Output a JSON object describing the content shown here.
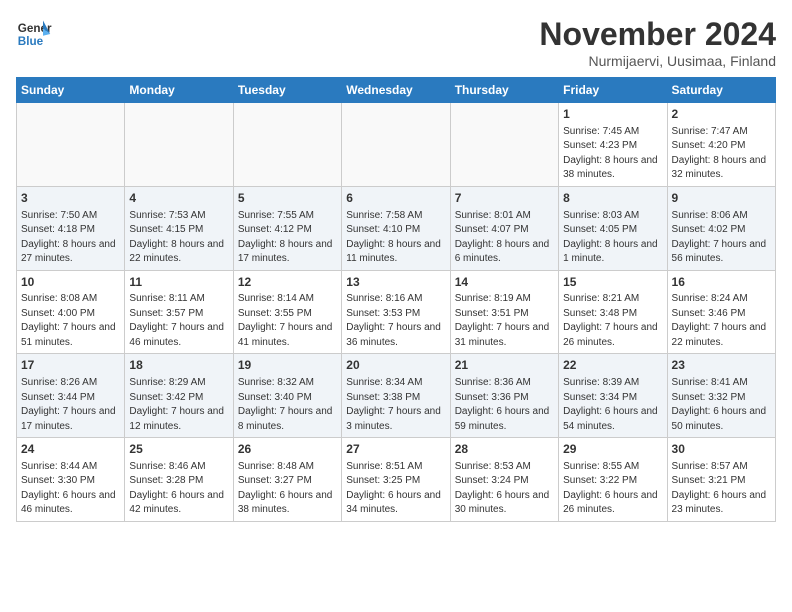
{
  "logo": {
    "line1": "General",
    "line2": "Blue"
  },
  "title": "November 2024",
  "subtitle": "Nurmijaervi, Uusimaa, Finland",
  "weekdays": [
    "Sunday",
    "Monday",
    "Tuesday",
    "Wednesday",
    "Thursday",
    "Friday",
    "Saturday"
  ],
  "weeks": [
    [
      {
        "day": "",
        "info": ""
      },
      {
        "day": "",
        "info": ""
      },
      {
        "day": "",
        "info": ""
      },
      {
        "day": "",
        "info": ""
      },
      {
        "day": "",
        "info": ""
      },
      {
        "day": "1",
        "info": "Sunrise: 7:45 AM\nSunset: 4:23 PM\nDaylight: 8 hours and 38 minutes."
      },
      {
        "day": "2",
        "info": "Sunrise: 7:47 AM\nSunset: 4:20 PM\nDaylight: 8 hours and 32 minutes."
      }
    ],
    [
      {
        "day": "3",
        "info": "Sunrise: 7:50 AM\nSunset: 4:18 PM\nDaylight: 8 hours and 27 minutes."
      },
      {
        "day": "4",
        "info": "Sunrise: 7:53 AM\nSunset: 4:15 PM\nDaylight: 8 hours and 22 minutes."
      },
      {
        "day": "5",
        "info": "Sunrise: 7:55 AM\nSunset: 4:12 PM\nDaylight: 8 hours and 17 minutes."
      },
      {
        "day": "6",
        "info": "Sunrise: 7:58 AM\nSunset: 4:10 PM\nDaylight: 8 hours and 11 minutes."
      },
      {
        "day": "7",
        "info": "Sunrise: 8:01 AM\nSunset: 4:07 PM\nDaylight: 8 hours and 6 minutes."
      },
      {
        "day": "8",
        "info": "Sunrise: 8:03 AM\nSunset: 4:05 PM\nDaylight: 8 hours and 1 minute."
      },
      {
        "day": "9",
        "info": "Sunrise: 8:06 AM\nSunset: 4:02 PM\nDaylight: 7 hours and 56 minutes."
      }
    ],
    [
      {
        "day": "10",
        "info": "Sunrise: 8:08 AM\nSunset: 4:00 PM\nDaylight: 7 hours and 51 minutes."
      },
      {
        "day": "11",
        "info": "Sunrise: 8:11 AM\nSunset: 3:57 PM\nDaylight: 7 hours and 46 minutes."
      },
      {
        "day": "12",
        "info": "Sunrise: 8:14 AM\nSunset: 3:55 PM\nDaylight: 7 hours and 41 minutes."
      },
      {
        "day": "13",
        "info": "Sunrise: 8:16 AM\nSunset: 3:53 PM\nDaylight: 7 hours and 36 minutes."
      },
      {
        "day": "14",
        "info": "Sunrise: 8:19 AM\nSunset: 3:51 PM\nDaylight: 7 hours and 31 minutes."
      },
      {
        "day": "15",
        "info": "Sunrise: 8:21 AM\nSunset: 3:48 PM\nDaylight: 7 hours and 26 minutes."
      },
      {
        "day": "16",
        "info": "Sunrise: 8:24 AM\nSunset: 3:46 PM\nDaylight: 7 hours and 22 minutes."
      }
    ],
    [
      {
        "day": "17",
        "info": "Sunrise: 8:26 AM\nSunset: 3:44 PM\nDaylight: 7 hours and 17 minutes."
      },
      {
        "day": "18",
        "info": "Sunrise: 8:29 AM\nSunset: 3:42 PM\nDaylight: 7 hours and 12 minutes."
      },
      {
        "day": "19",
        "info": "Sunrise: 8:32 AM\nSunset: 3:40 PM\nDaylight: 7 hours and 8 minutes."
      },
      {
        "day": "20",
        "info": "Sunrise: 8:34 AM\nSunset: 3:38 PM\nDaylight: 7 hours and 3 minutes."
      },
      {
        "day": "21",
        "info": "Sunrise: 8:36 AM\nSunset: 3:36 PM\nDaylight: 6 hours and 59 minutes."
      },
      {
        "day": "22",
        "info": "Sunrise: 8:39 AM\nSunset: 3:34 PM\nDaylight: 6 hours and 54 minutes."
      },
      {
        "day": "23",
        "info": "Sunrise: 8:41 AM\nSunset: 3:32 PM\nDaylight: 6 hours and 50 minutes."
      }
    ],
    [
      {
        "day": "24",
        "info": "Sunrise: 8:44 AM\nSunset: 3:30 PM\nDaylight: 6 hours and 46 minutes."
      },
      {
        "day": "25",
        "info": "Sunrise: 8:46 AM\nSunset: 3:28 PM\nDaylight: 6 hours and 42 minutes."
      },
      {
        "day": "26",
        "info": "Sunrise: 8:48 AM\nSunset: 3:27 PM\nDaylight: 6 hours and 38 minutes."
      },
      {
        "day": "27",
        "info": "Sunrise: 8:51 AM\nSunset: 3:25 PM\nDaylight: 6 hours and 34 minutes."
      },
      {
        "day": "28",
        "info": "Sunrise: 8:53 AM\nSunset: 3:24 PM\nDaylight: 6 hours and 30 minutes."
      },
      {
        "day": "29",
        "info": "Sunrise: 8:55 AM\nSunset: 3:22 PM\nDaylight: 6 hours and 26 minutes."
      },
      {
        "day": "30",
        "info": "Sunrise: 8:57 AM\nSunset: 3:21 PM\nDaylight: 6 hours and 23 minutes."
      }
    ]
  ]
}
